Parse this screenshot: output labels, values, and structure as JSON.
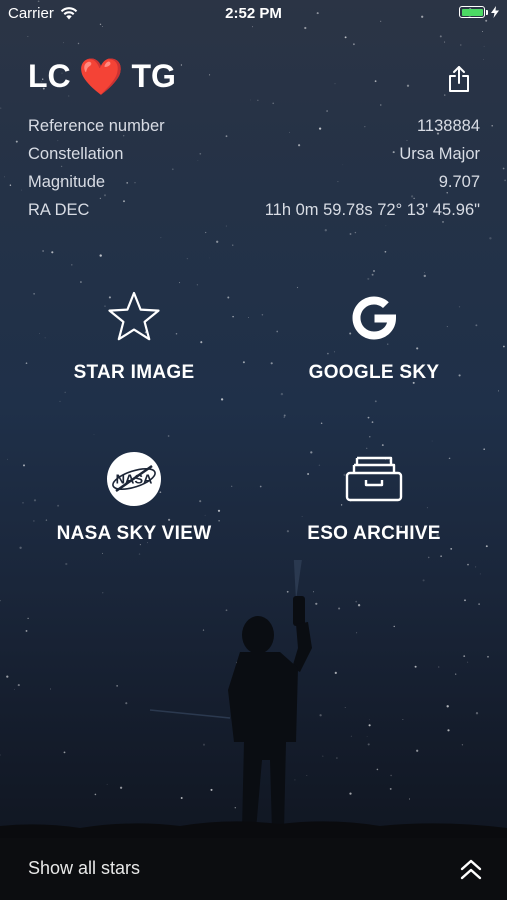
{
  "status_bar": {
    "carrier": "Carrier",
    "time": "2:52 PM"
  },
  "header": {
    "title_left": "LC",
    "title_heart": "❤️",
    "title_right": "TG"
  },
  "info": [
    {
      "label": "Reference number",
      "value": "1138884"
    },
    {
      "label": "Constellation",
      "value": "Ursa Major"
    },
    {
      "label": "Magnitude",
      "value": "9.707"
    },
    {
      "label": "RA DEC",
      "value": "11h 0m 59.78s 72° 13' 45.96\""
    }
  ],
  "actions": [
    {
      "label": "STAR IMAGE",
      "icon": "star-icon"
    },
    {
      "label": "GOOGLE SKY",
      "icon": "google-icon"
    },
    {
      "label": "NASA SKY VIEW",
      "icon": "nasa-icon"
    },
    {
      "label": "ESO ARCHIVE",
      "icon": "archive-tray-icon"
    }
  ],
  "nasa_logo_text": "NASA",
  "bottom_bar": {
    "label": "Show all stars",
    "icon": "double-chevron-up-icon"
  },
  "colors": {
    "heart": "#e0142a",
    "battery": "#4cd964",
    "bottom_bar": "#0c0d10"
  }
}
